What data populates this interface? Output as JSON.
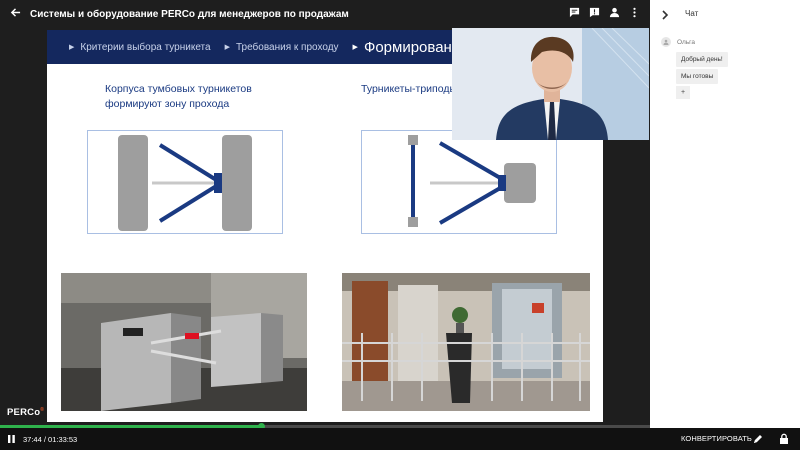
{
  "header": {
    "title": "Системы и оборудование PERCo для менеджеров по продажам"
  },
  "slide": {
    "crumbs": [
      {
        "label": "Критерии выбора турникета"
      },
      {
        "label": "Требования к проходу"
      },
      {
        "label": "Формирование"
      }
    ],
    "caption_left": "Корпуса тумбовых турникетов формируют зону прохода",
    "caption_right": "Турникеты-триподы с системой ограждения"
  },
  "logo": {
    "text": "PERCo",
    "mark": "®"
  },
  "player": {
    "time": "37:44 / 01:33:53",
    "progress": 0.402,
    "convert_label": "КОНВЕРТИРОВАТЬ"
  },
  "chat": {
    "title": "Чат",
    "user": {
      "name": "Ольга"
    },
    "messages": [
      {
        "text": "Добрый день!"
      },
      {
        "text": "Мы готовы"
      }
    ],
    "plus_label": "+"
  },
  "icons": {
    "back": "arrow-left-icon",
    "chat": "chat-icon",
    "comment": "comment-alert-icon",
    "person": "person-icon",
    "more": "more-vert-icon",
    "pause": "pause-icon",
    "edit": "pencil-icon",
    "lock": "lock-icon",
    "collapse": "chevron-right-icon"
  },
  "colors": {
    "accent": "#2fb24c",
    "slide_header": "#14285e",
    "caption": "#1a3a82"
  }
}
